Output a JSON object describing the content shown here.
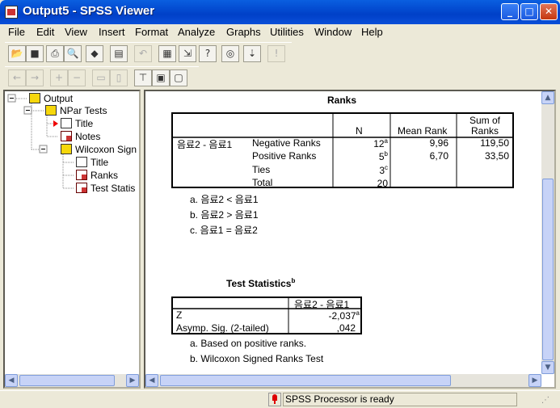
{
  "window": {
    "title": "Output5 - SPSS Viewer",
    "btn_min": "_",
    "btn_max": "□",
    "btn_close": "✕"
  },
  "menu": [
    "File",
    "Edit",
    "View",
    "Insert",
    "Format",
    "Analyze",
    "Graphs",
    "Utilities",
    "Window",
    "Help"
  ],
  "tree": {
    "output": "Output",
    "npar": "NPar Tests",
    "title1": "Title",
    "notes": "Notes",
    "wilcoxon": "Wilcoxon Sign",
    "title2": "Title",
    "ranks": "Ranks",
    "teststats": "Test Statis"
  },
  "ranks": {
    "title": "Ranks",
    "headers": {
      "n": "N",
      "mean_rank": "Mean Rank",
      "sum_ranks_1": "Sum of",
      "sum_ranks_2": "Ranks"
    },
    "row_group": "음료2 - 음료1",
    "rows": [
      {
        "label": "Negative Ranks",
        "n": "12",
        "sup": "a",
        "mean": "9,96",
        "sum": "119,50"
      },
      {
        "label": "Positive Ranks",
        "n": "5",
        "sup": "b",
        "mean": "6,70",
        "sum": "33,50"
      },
      {
        "label": "Ties",
        "n": "3",
        "sup": "c",
        "mean": "",
        "sum": ""
      },
      {
        "label": "Total",
        "n": "20",
        "sup": "",
        "mean": "",
        "sum": ""
      }
    ],
    "footnotes": [
      "a. 음료2 < 음료1",
      "b. 음료2 > 음료1",
      "c. 음료1 = 음료2"
    ]
  },
  "test_stats": {
    "title": "Test Statistics",
    "title_sup": "b",
    "col_header": "음료2 - 음료1",
    "rows": [
      {
        "label": "Z",
        "value": "-2,037",
        "sup": "a"
      },
      {
        "label": "Asymp. Sig. (2-tailed)",
        "value": ",042",
        "sup": ""
      }
    ],
    "footnotes": [
      "a. Based on positive ranks.",
      "b. Wilcoxon Signed Ranks Test"
    ]
  },
  "status": {
    "text": "SPSS Processor  is ready"
  }
}
